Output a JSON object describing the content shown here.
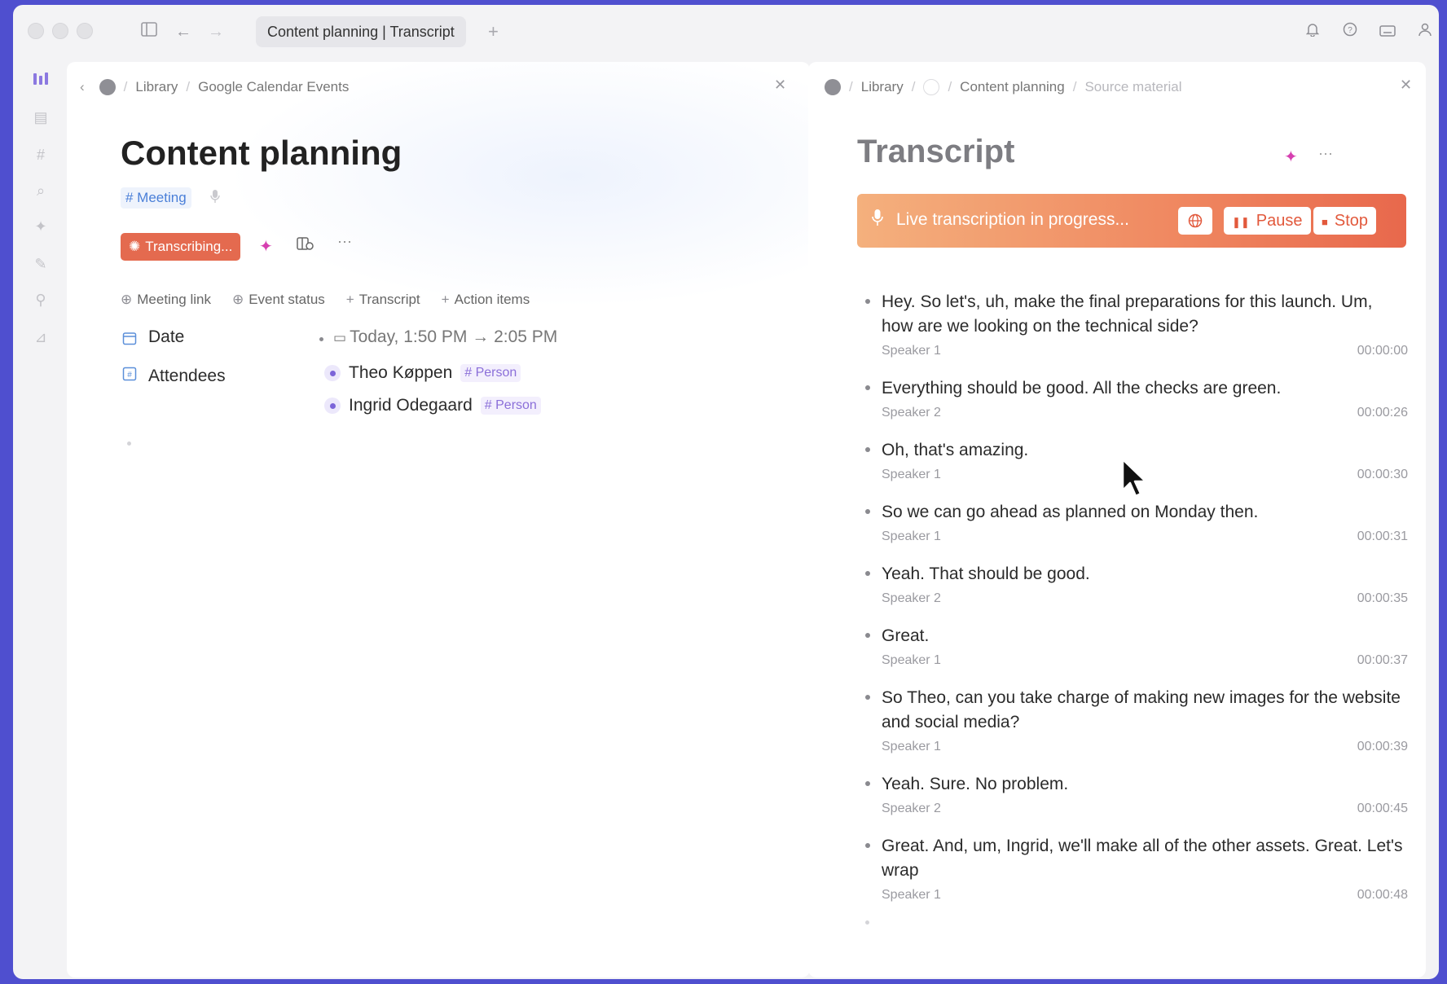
{
  "titlebar": {
    "tab_label": "Content planning | Transcript",
    "new_tab": "+",
    "icons": [
      "sidebar-toggle-icon",
      "back-arrow-icon",
      "forward-arrow-icon",
      "bell-icon",
      "help-icon",
      "keyboard-icon",
      "user-icon"
    ]
  },
  "rail": {
    "icons": [
      "dashboard-icon",
      "calendar-icon",
      "hashtag-icon",
      "search-icon",
      "sparkle-icon",
      "edit-icon",
      "pin-icon",
      "chart-icon"
    ]
  },
  "left": {
    "breadcrumb": [
      "Library",
      "Google Calendar Events"
    ],
    "title": "Content planning",
    "tag": "# Meeting",
    "transcribing_label": "Transcribing...",
    "property_actions": [
      {
        "prefix": "⊕",
        "label": "Meeting link"
      },
      {
        "prefix": "⊕",
        "label": "Event status"
      },
      {
        "prefix": "+",
        "label": "Transcript"
      },
      {
        "prefix": "+",
        "label": "Action items"
      }
    ],
    "date_label": "Date",
    "date_value": "Today, 1:50 PM → 2:05 PM",
    "attendees_label": "Attendees",
    "attendees": [
      {
        "name": "Theo Køppen",
        "tag": "# Person"
      },
      {
        "name": "Ingrid Odegaard",
        "tag": "# Person"
      }
    ]
  },
  "right": {
    "breadcrumb": [
      "Library",
      "Content planning",
      "Source material"
    ],
    "title": "Transcript",
    "banner": {
      "text": "Live transcription in progress...",
      "pause": "Pause",
      "stop": "Stop"
    },
    "entries": [
      {
        "text": "Hey. So let's, uh, make the final preparations for this launch. Um, how are we looking on the technical side?",
        "speaker": "Speaker 1",
        "time": "00:00:00"
      },
      {
        "text": "Everything should be good. All the checks are green.",
        "speaker": "Speaker 2",
        "time": "00:00:26"
      },
      {
        "text": "Oh, that's amazing.",
        "speaker": "Speaker 1",
        "time": "00:00:30"
      },
      {
        "text": "So we can go ahead as planned on Monday then.",
        "speaker": "Speaker 1",
        "time": "00:00:31"
      },
      {
        "text": "Yeah. That should be good.",
        "speaker": "Speaker 2",
        "time": "00:00:35"
      },
      {
        "text": "Great.",
        "speaker": "Speaker 1",
        "time": "00:00:37"
      },
      {
        "text": "So Theo, can you take charge of making new images for the website and social media?",
        "speaker": "Speaker 1",
        "time": "00:00:39"
      },
      {
        "text": "Yeah. Sure. No problem.",
        "speaker": "Speaker 2",
        "time": "00:00:45"
      },
      {
        "text": "Great. And, um, Ingrid, we'll make all of the other assets. Great. Let's wrap",
        "speaker": "Speaker 1",
        "time": "00:00:48"
      }
    ]
  },
  "colors": {
    "accent_orange": "#e46a4f",
    "tag_blue": "#4a7fd8",
    "person_purple": "#8b6fd9",
    "sparkle_pink": "#d63fb0"
  }
}
